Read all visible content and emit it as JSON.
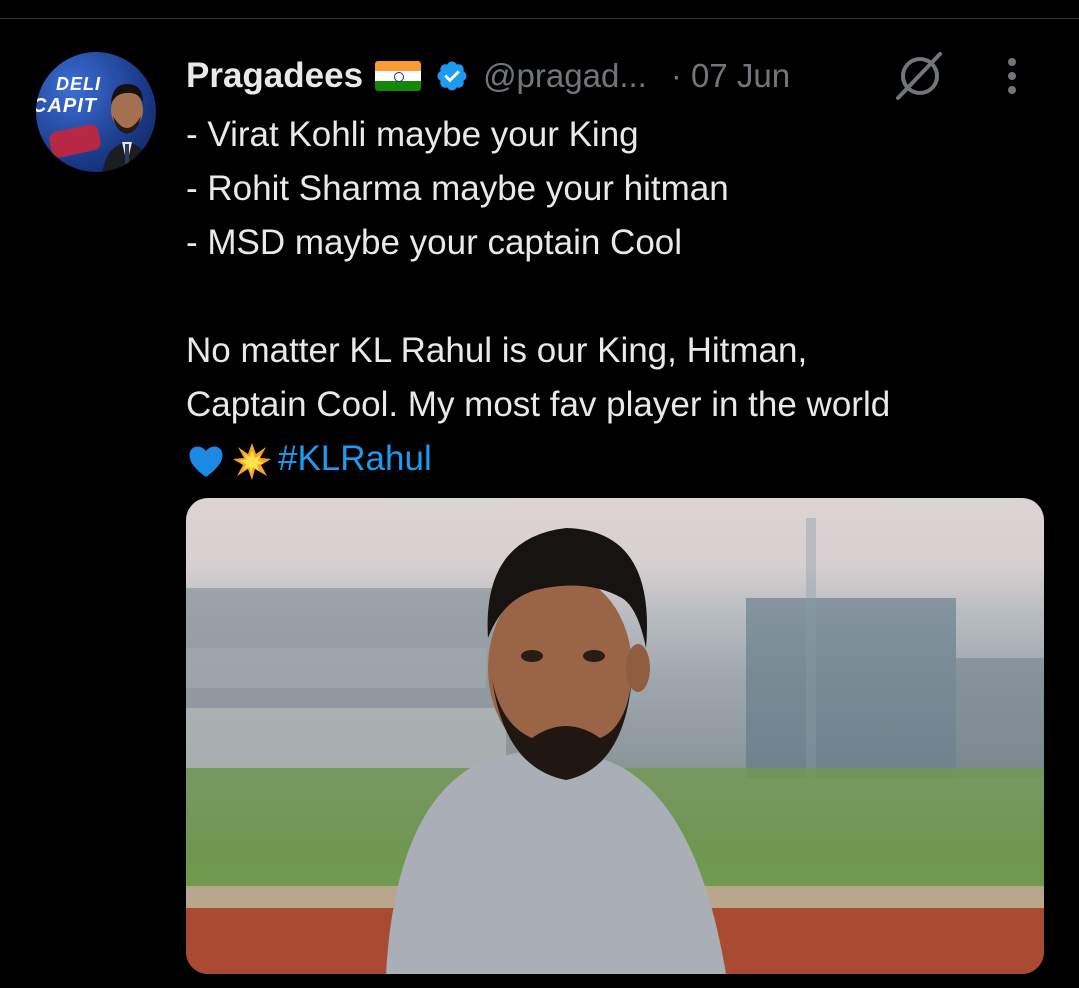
{
  "tweet": {
    "display_name": "Pragadees",
    "handle": "@pragad...",
    "date_separator": "·",
    "date": "07 Jun",
    "lines": [
      "- Virat Kohli maybe your King",
      "- Rohit Sharma maybe your hitman",
      "- MSD maybe your captain Cool",
      "",
      "No matter KL Rahul is our King, Hitman,",
      "Captain Cool. My most fav player in the world"
    ],
    "hashtag": "#KLRahul"
  },
  "avatar": {
    "text_line1": "DELI",
    "text_line2": "CAPIT"
  },
  "icons": {
    "verified": "verified-badge-icon",
    "grok": "grok-icon",
    "more": "more-vertical-icon",
    "flag": "india-flag-emoji",
    "heart": "blue-heart-emoji",
    "collision": "collision-emoji"
  },
  "colors": {
    "background": "#000000",
    "text": "#e7e9ea",
    "muted": "#71767b",
    "accent": "#1d9bf0"
  }
}
